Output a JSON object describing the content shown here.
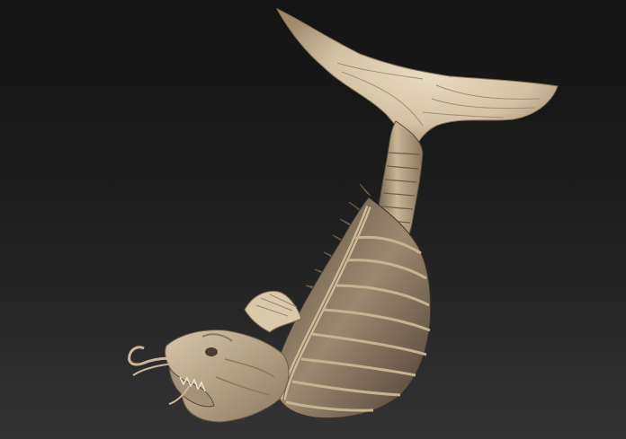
{
  "viewport": {
    "background_top": "#141414",
    "background_bottom": "#343434"
  },
  "model": {
    "subject": "fish-dragon-sculpt",
    "material_light": "#e8d8bd",
    "material_mid": "#b39f82",
    "material_dark": "#5e5041",
    "material_deep": "#3a2f26"
  }
}
